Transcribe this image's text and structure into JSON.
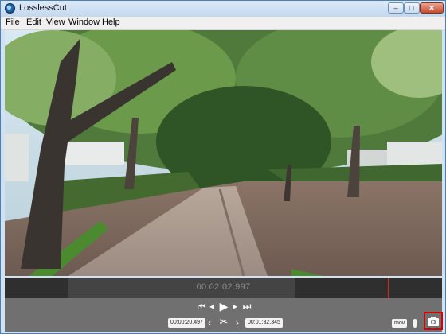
{
  "app": {
    "title": "LosslessCut",
    "icon": "losslesscut-app-icon"
  },
  "window_controls": {
    "minimize": "–",
    "maximize": "□",
    "close": "✕"
  },
  "menu": [
    "File",
    "Edit",
    "View",
    "Window",
    "Help"
  ],
  "timeline": {
    "current_time": "00:02:02.997"
  },
  "playback": {
    "jump_start_icon": "⏮",
    "prev_frame_icon": "◂",
    "play_icon": "▶",
    "next_frame_icon": "▸",
    "jump_end_icon": "⏭"
  },
  "cut": {
    "start_time": "00:00:20.497",
    "end_time": "00:01:32.345",
    "set_start_icon": "‹",
    "scissors_icon": "✂",
    "set_end_icon": "›"
  },
  "export": {
    "format": "mov",
    "camera_icon": "camera-icon"
  },
  "colors": {
    "accent": "#d80000",
    "timeline_bg": "#444444",
    "controls_bg": "#707070"
  }
}
